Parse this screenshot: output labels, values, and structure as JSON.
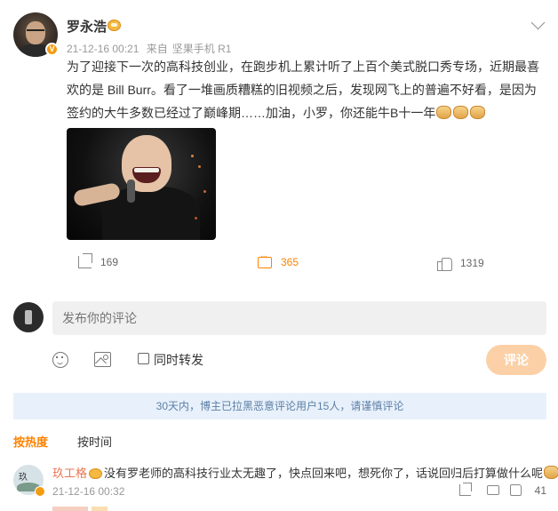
{
  "post": {
    "author": "罗永浩",
    "verified_badge": "V",
    "time": "21-12-16 00:21",
    "source_prefix": "来自",
    "source_device": "坚果手机 R1",
    "text": "为了迎接下一次的高科技创业，在跑步机上累计听了上百个美式脱口秀专场，近期最喜欢的是 Bill Burr。看了一堆画质糟糕的旧视频之后，发现网飞上的普遍不好看，是因为签约的大牛多数已经过了巅峰期……加油，小罗，你还能牛B十一年",
    "emojis": [
      "fist-emoji",
      "fist-emoji",
      "fist-emoji"
    ],
    "image": "comedian-photo"
  },
  "actions": {
    "share_count": "169",
    "comment_count": "365",
    "like_count": "1319"
  },
  "composer": {
    "placeholder": "发布你的评论",
    "repost_label": "同时转发",
    "submit_label": "评论"
  },
  "notice": "30天内，博主已拉黑恶意评论用户15人，请谨慎评论",
  "sort": {
    "active": "按热度",
    "inactive": "按时间"
  },
  "comments": [
    {
      "author": "玖工格",
      "text": "没有罗老师的高科技行业太无趣了，快点回来吧，想死你了，话说回归后打算做什么呢",
      "time": "21-12-16 00:32",
      "like_count": "41"
    }
  ],
  "colors": {
    "accent": "#ff8200",
    "author_link": "#eb7350",
    "notice_bg": "#e8f1fb",
    "submit_bg": "#fcd0a6"
  }
}
